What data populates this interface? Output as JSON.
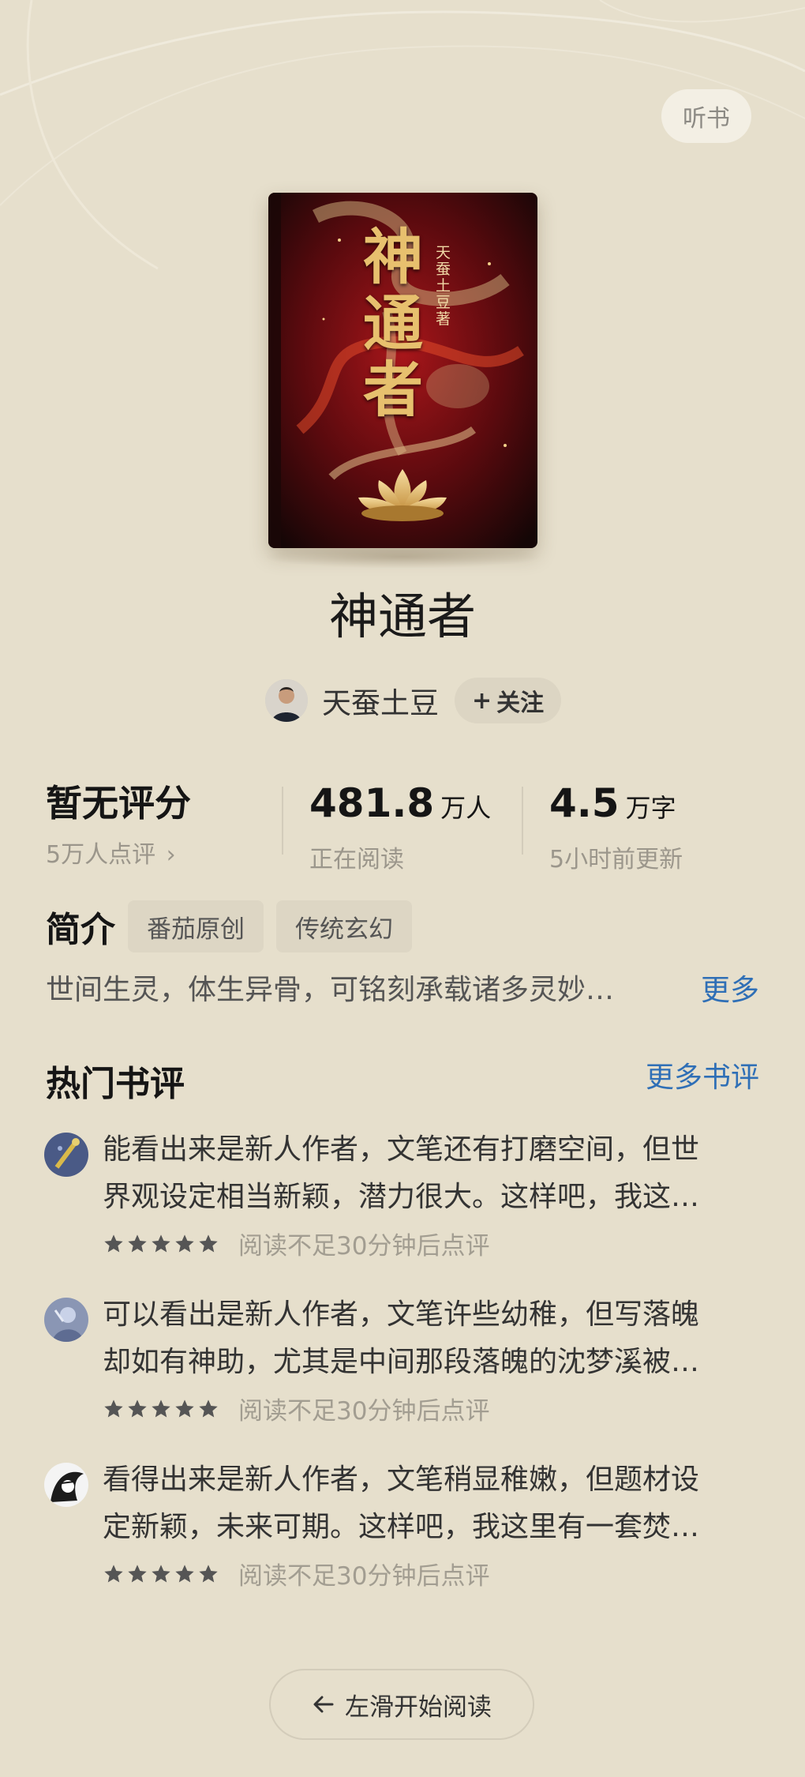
{
  "header": {
    "listen_label": "听书"
  },
  "cover": {
    "title_text": "神通者",
    "author_text": "天蚕土豆著"
  },
  "book": {
    "title": "神通者"
  },
  "author": {
    "name": "天蚕土豆",
    "follow_label": "关注"
  },
  "stats": {
    "rating": {
      "value": "暂无评分",
      "sub": "5万人点评"
    },
    "readers": {
      "value": "481.8",
      "unit": "万人",
      "sub": "正在阅读"
    },
    "words": {
      "value": "4.5",
      "unit": "万字",
      "sub": "5小时前更新"
    }
  },
  "intro": {
    "title": "简介",
    "tags": [
      "番茄原创",
      "传统玄幻"
    ],
    "text": "世间生灵，体生异骨，可铭刻承载诸多灵妙…",
    "more_label": "更多"
  },
  "reviews_section": {
    "title": "热门书评",
    "more_label": "更多书评"
  },
  "reviews": [
    {
      "line1": "能看出来是新人作者，文笔还有打磨空间，但世",
      "line2": "界观设定相当新颖，潜力很大。这样吧，我这…",
      "meta": "阅读不足30分钟后点评",
      "stars": 5
    },
    {
      "line1": "可以看出是新人作者，文笔许些幼稚，但写落魄",
      "line2": "却如有神助，尤其是中间那段落魄的沈梦溪被…",
      "meta": "阅读不足30分钟后点评",
      "stars": 5
    },
    {
      "line1": "看得出来是新人作者，文笔稍显稚嫩，但题材设",
      "line2": "定新颖，未来可期。这样吧，我这里有一套焚…",
      "meta": "阅读不足30分钟后点评",
      "stars": 5
    }
  ],
  "footer": {
    "start_label": "左滑开始阅读"
  },
  "colors": {
    "background": "#e6dfcc",
    "link": "#2f6fb6",
    "tag_bg": "#ddd6c4"
  }
}
